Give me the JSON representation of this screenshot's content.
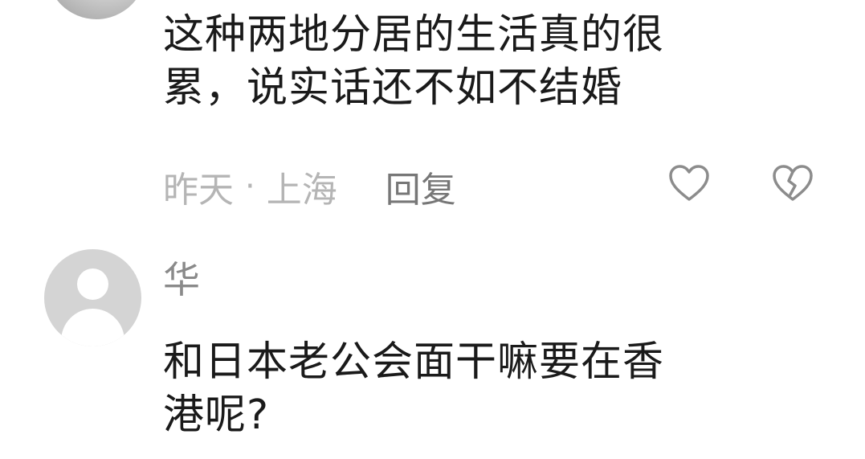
{
  "comments": [
    {
      "text_line1": "这种两地分居的生活真的很",
      "text_line2": "累，说实话还不如不结婚",
      "time": "昨天",
      "separator": "·",
      "location": "上海",
      "reply_label": "回复"
    },
    {
      "username": "华",
      "text_line1": "和日本老公会面干嘛要在香",
      "text_line2": "港呢?"
    }
  ],
  "icons": {
    "like": "heart-outline-icon",
    "dislike": "broken-heart-icon",
    "avatar_placeholder": "default-user-avatar"
  },
  "colors": {
    "text": "#1a1a1a",
    "meta": "#b5b5b5",
    "reply": "#777777",
    "username": "#8a8a8a",
    "icon_stroke": "#8c8c8c"
  }
}
